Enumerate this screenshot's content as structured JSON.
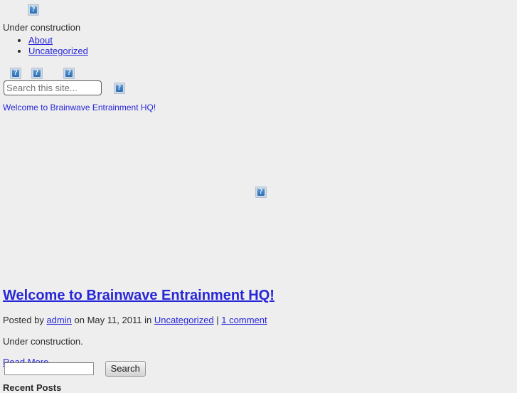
{
  "page": {
    "background_color": "#efeeee",
    "link_color": "#2727d8",
    "text_color": "#2b2b2b"
  },
  "header": {
    "logo_icon": "broken-image-icon",
    "tagline": "Under construction"
  },
  "nav": {
    "items": [
      {
        "label": "About"
      },
      {
        "label": "Uncategorized"
      }
    ]
  },
  "social": {
    "icons": [
      {
        "name": "broken-image-icon"
      },
      {
        "name": "broken-image-icon"
      },
      {
        "name": "broken-image-icon"
      }
    ]
  },
  "search": {
    "placeholder": "Search this site...",
    "value": "",
    "button_icon": "broken-image-icon"
  },
  "featured": {
    "link_label": "Welcome to Brainwave Entrainment HQ!",
    "image_icon": "broken-image-icon"
  },
  "post": {
    "title": "Welcome to Brainwave Entrainment HQ!",
    "meta": {
      "posted_by_prefix": "Posted by",
      "author": "admin",
      "date_prefix": "on",
      "date": "May 11, 2011",
      "category_prefix": "in",
      "category": "Uncategorized",
      "separator": "|",
      "comments": "1 comment"
    },
    "excerpt": "Under construction.",
    "read_more_label": "Read More"
  },
  "bottom_search": {
    "value": "",
    "placeholder": "",
    "button_label": "Search"
  },
  "sidebar": {
    "recent_posts_heading": "Recent Posts"
  }
}
